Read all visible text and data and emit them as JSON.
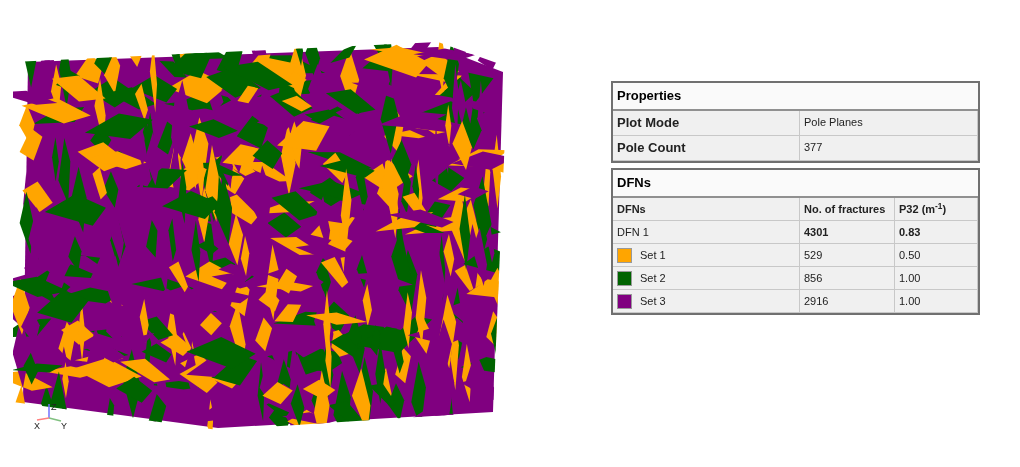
{
  "viewport": {
    "axes": {
      "x": "X",
      "y": "Y",
      "z": "Z"
    }
  },
  "properties": {
    "title": "Properties",
    "rows": [
      {
        "label": "Plot Mode",
        "value": "Pole Planes"
      },
      {
        "label": "Pole Count",
        "value": "377"
      }
    ]
  },
  "dfns": {
    "title": "DFNs",
    "columns": [
      "DFNs",
      "No. of fractures",
      "P32 (m$^{-1}$)"
    ],
    "rows": [
      {
        "kind": "total",
        "name": "DFN 1",
        "fractures": "4301",
        "p32": "0.83"
      },
      {
        "kind": "set",
        "name": "Set 1",
        "color": "#ffa500",
        "fractures": "529",
        "p32": "0.50"
      },
      {
        "kind": "set",
        "name": "Set 2",
        "color": "#006400",
        "fractures": "856",
        "p32": "1.00"
      },
      {
        "kind": "set",
        "name": "Set 3",
        "color": "#800080",
        "fractures": "2916",
        "p32": "1.00"
      }
    ]
  }
}
